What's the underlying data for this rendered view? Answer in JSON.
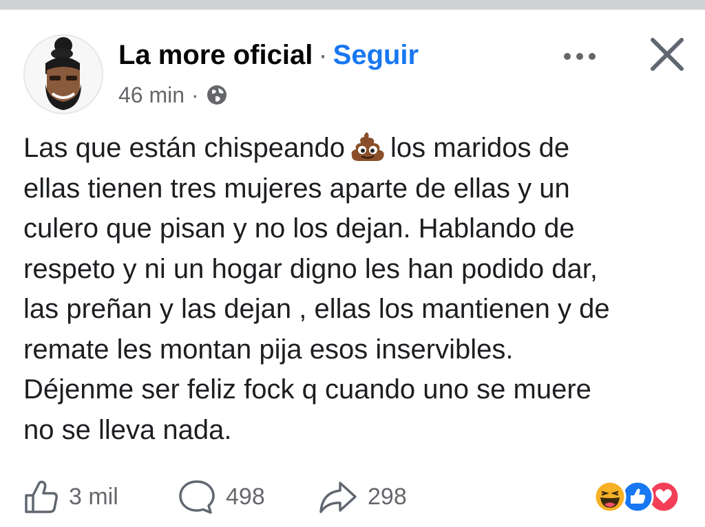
{
  "post": {
    "author": "La more oficial",
    "separator": "·",
    "follow_label": "Seguir",
    "time": "46 min",
    "time_separator": "·",
    "audience_icon": "globe-icon",
    "text_lines": [
      "Las que están chispeando",
      "los maridos de",
      "ellas tienen tres mujeres aparte de ellas y un",
      "culero que pisan y no los dejan. Hablando de",
      "respeto y ni un hogar digno les han podido dar,",
      "las preñan y las dejan , ellas los mantienen y de",
      "remate les montan pija esos inservibles.",
      "Déjenme ser feliz fock q cuando uno se muere",
      "no se lleva nada."
    ],
    "inline_emoji": "pile-of-poo-emoji"
  },
  "footer": {
    "likes": "3 mil",
    "comments": "498",
    "shares": "298",
    "reactions": [
      "haha",
      "like",
      "love"
    ]
  },
  "colors": {
    "accent": "#1877f2",
    "secondary_text": "#65676b",
    "love": "#f33e58",
    "haha": "#f7b125"
  }
}
